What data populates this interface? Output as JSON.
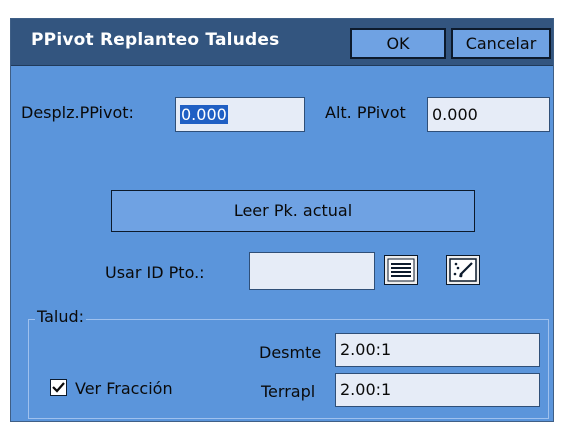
{
  "dialog": {
    "title": "PPivot Replanteo Taludes",
    "ok_label": "OK",
    "cancel_label": "Cancelar"
  },
  "fields": {
    "desplz_label": "Desplz.PPivot:",
    "desplz_value": "0.000",
    "alt_label": "Alt. PPivot",
    "alt_value": "0.000"
  },
  "buttons": {
    "leer_pk_label": "Leer Pk. actual",
    "list_icon": "list-icon",
    "map_select_icon": "map-select-icon"
  },
  "usar_id": {
    "label": "Usar ID Pto.:",
    "value": ""
  },
  "talud": {
    "group_title": "Talud:",
    "desmte_label": "Desmte",
    "desmte_value": "2.00:1",
    "terrapl_label": "Terrapl",
    "terrapl_value": "2.00:1",
    "ver_fraccion_label": "Ver Fracción",
    "ver_fraccion_checked": true
  },
  "colors": {
    "dialog_bg": "#5b95db",
    "titlebar_bg": "#33557f",
    "input_bg": "#e6ecf7",
    "selection": "#1f5fc4"
  }
}
